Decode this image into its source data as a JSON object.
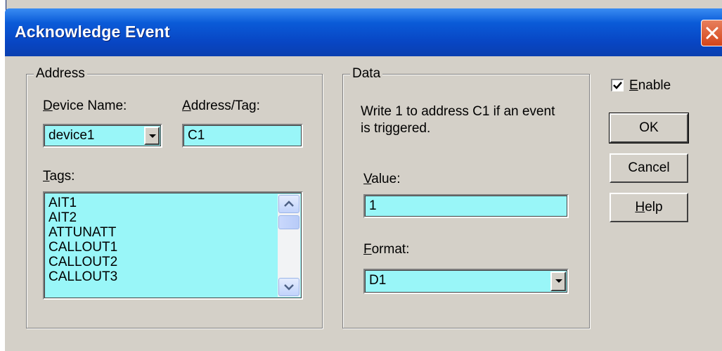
{
  "window": {
    "title": "Acknowledge Event"
  },
  "address": {
    "group_title": "Address",
    "device_name_label_u": "D",
    "device_name_label_rest": "evice Name:",
    "device_name_value": "device1",
    "address_tag_label_u": "A",
    "address_tag_label_rest": "ddress/Tag:",
    "address_tag_value": "C1",
    "tags_label_u": "T",
    "tags_label_rest": "ags:",
    "tags": [
      "AIT1",
      "AIT2",
      "ATTUNATT",
      "CALLOUT1",
      "CALLOUT2",
      "CALLOUT3"
    ]
  },
  "data": {
    "group_title": "Data",
    "description_line1": "Write 1 to address C1 if an event",
    "description_line2": "is triggered.",
    "value_label_u": "V",
    "value_label_rest": "alue:",
    "value_value": "1",
    "format_label_u": "F",
    "format_label_rest": "ormat:",
    "format_value": "D1"
  },
  "controls": {
    "enable_checked": true,
    "enable_label_u": "E",
    "enable_label_rest": "nable",
    "ok_label": "OK",
    "cancel_label": "Cancel",
    "help_label_u": "H",
    "help_label_rest": "elp"
  },
  "colors": {
    "field_bg": "#99f6f8",
    "dialog_bg": "#d4d0c8",
    "title_bar": "#0a5bd8",
    "close_button": "#d5451a"
  },
  "icons": [
    "close-icon",
    "chevron-down-icon",
    "chevron-up-icon",
    "checkmark-icon"
  ]
}
